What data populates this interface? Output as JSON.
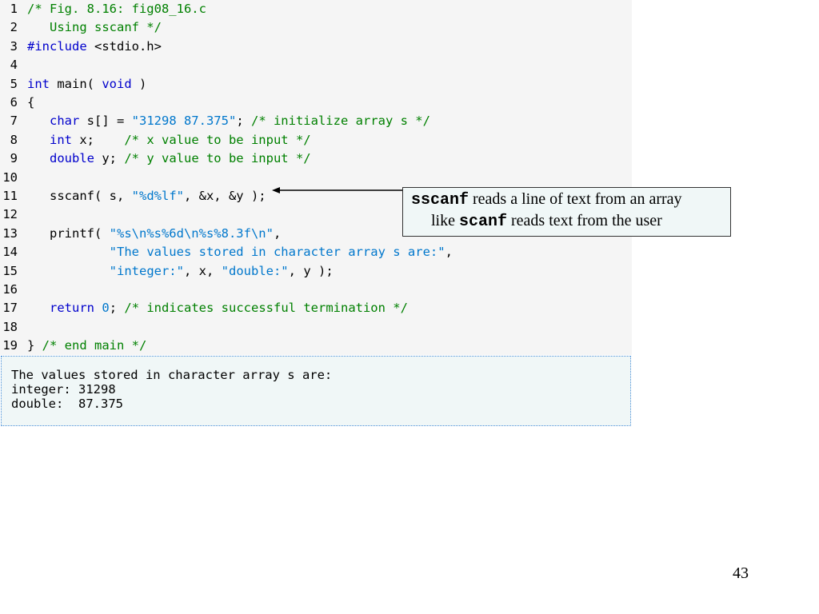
{
  "code": {
    "lines": [
      {
        "n": "1",
        "segs": [
          {
            "c": "cm",
            "t": "/* Fig. 8.16: fig08_16.c"
          }
        ]
      },
      {
        "n": "2",
        "segs": [
          {
            "c": "cm",
            "t": "   Using sscanf */"
          }
        ]
      },
      {
        "n": "3",
        "segs": [
          {
            "c": "kw",
            "t": "#include"
          },
          {
            "c": "",
            "t": " <stdio.h>"
          }
        ]
      },
      {
        "n": "4",
        "segs": []
      },
      {
        "n": "5",
        "segs": [
          {
            "c": "kw",
            "t": "int"
          },
          {
            "c": "",
            "t": " main( "
          },
          {
            "c": "kw",
            "t": "void"
          },
          {
            "c": "",
            "t": " )"
          }
        ]
      },
      {
        "n": "6",
        "segs": [
          {
            "c": "",
            "t": "{"
          }
        ]
      },
      {
        "n": "7",
        "segs": [
          {
            "c": "",
            "t": "   "
          },
          {
            "c": "kw",
            "t": "char"
          },
          {
            "c": "",
            "t": " s[] = "
          },
          {
            "c": "st",
            "t": "\"31298 87.375\""
          },
          {
            "c": "",
            "t": "; "
          },
          {
            "c": "cm",
            "t": "/* initialize array s */"
          }
        ]
      },
      {
        "n": "8",
        "segs": [
          {
            "c": "",
            "t": "   "
          },
          {
            "c": "kw",
            "t": "int"
          },
          {
            "c": "",
            "t": " x;    "
          },
          {
            "c": "cm",
            "t": "/* x value to be input */"
          }
        ]
      },
      {
        "n": "9",
        "segs": [
          {
            "c": "",
            "t": "   "
          },
          {
            "c": "kw",
            "t": "double"
          },
          {
            "c": "",
            "t": " y; "
          },
          {
            "c": "cm",
            "t": "/* y value to be input */"
          }
        ]
      },
      {
        "n": "10",
        "segs": []
      },
      {
        "n": "11",
        "segs": [
          {
            "c": "",
            "t": "   sscanf( s, "
          },
          {
            "c": "st",
            "t": "\"%d%lf\""
          },
          {
            "c": "",
            "t": ", &x, &y );"
          }
        ]
      },
      {
        "n": "12",
        "segs": []
      },
      {
        "n": "13",
        "segs": [
          {
            "c": "",
            "t": "   printf( "
          },
          {
            "c": "st",
            "t": "\"%s\\n%s%6d\\n%s%8.3f\\n\""
          },
          {
            "c": "",
            "t": ","
          }
        ]
      },
      {
        "n": "14",
        "segs": [
          {
            "c": "",
            "t": "           "
          },
          {
            "c": "st",
            "t": "\"The values stored in character array s are:\""
          },
          {
            "c": "",
            "t": ","
          }
        ]
      },
      {
        "n": "15",
        "segs": [
          {
            "c": "",
            "t": "           "
          },
          {
            "c": "st",
            "t": "\"integer:\""
          },
          {
            "c": "",
            "t": ", x, "
          },
          {
            "c": "st",
            "t": "\"double:\""
          },
          {
            "c": "",
            "t": ", y );"
          }
        ]
      },
      {
        "n": "16",
        "segs": []
      },
      {
        "n": "17",
        "segs": [
          {
            "c": "",
            "t": "   "
          },
          {
            "c": "kw",
            "t": "return"
          },
          {
            "c": "",
            "t": " "
          },
          {
            "c": "num",
            "t": "0"
          },
          {
            "c": "",
            "t": "; "
          },
          {
            "c": "cm",
            "t": "/* indicates successful termination */"
          }
        ]
      },
      {
        "n": "18",
        "segs": []
      },
      {
        "n": "19",
        "segs": [
          {
            "c": "",
            "t": "} "
          },
          {
            "c": "cm",
            "t": "/* end main */"
          }
        ]
      }
    ]
  },
  "output": {
    "lines": [
      "The values stored in character array s are:",
      "integer: 31298",
      "double:  87.375"
    ]
  },
  "callout": {
    "line1_code": "sscanf",
    "line1_text": " reads a line of text from an array",
    "line2_prefix": "like ",
    "line2_code": "scanf",
    "line2_text": " reads text from the user"
  },
  "page_number": "43",
  "colors": {
    "keyword": "#0000cc",
    "comment": "#008000",
    "string": "#0077cc",
    "code_bg": "#f5f5f5",
    "output_bg": "#f0f7f7"
  }
}
